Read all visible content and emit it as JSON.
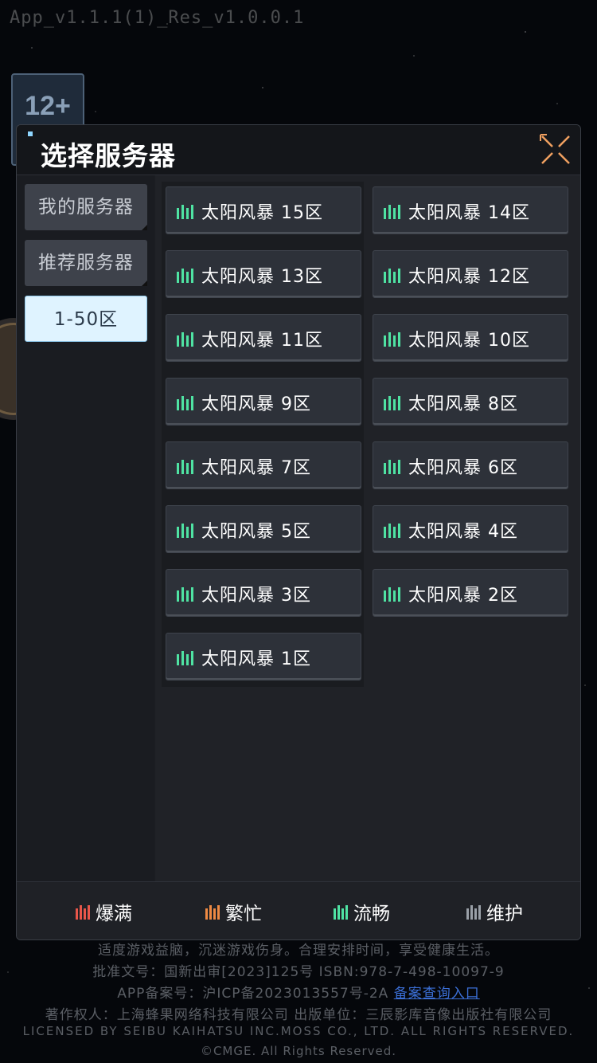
{
  "version": "App_v1.1.1(1)_Res_v1.0.0.1",
  "age_badge": "12+",
  "dialog": {
    "title": "选择服务器",
    "tabs": [
      {
        "label": "我的服务器",
        "active": false
      },
      {
        "label": "推荐服务器",
        "active": false
      },
      {
        "label": "1-50区",
        "active": true
      }
    ],
    "servers": [
      {
        "name": "太阳风暴 15区",
        "status": "smooth"
      },
      {
        "name": "太阳风暴 14区",
        "status": "smooth"
      },
      {
        "name": "太阳风暴 13区",
        "status": "smooth"
      },
      {
        "name": "太阳风暴 12区",
        "status": "smooth"
      },
      {
        "name": "太阳风暴 11区",
        "status": "smooth"
      },
      {
        "name": "太阳风暴 10区",
        "status": "smooth"
      },
      {
        "name": "太阳风暴 9区",
        "status": "smooth"
      },
      {
        "name": "太阳风暴 8区",
        "status": "smooth"
      },
      {
        "name": "太阳风暴 7区",
        "status": "smooth"
      },
      {
        "name": "太阳风暴 6区",
        "status": "smooth"
      },
      {
        "name": "太阳风暴 5区",
        "status": "smooth"
      },
      {
        "name": "太阳风暴 4区",
        "status": "smooth"
      },
      {
        "name": "太阳风暴 3区",
        "status": "smooth"
      },
      {
        "name": "太阳风暴 2区",
        "status": "smooth"
      },
      {
        "name": "太阳风暴 1区",
        "status": "smooth"
      }
    ],
    "legend": [
      {
        "label": "爆满",
        "color": "#e8564a"
      },
      {
        "label": "繁忙",
        "color": "#ef8a43"
      },
      {
        "label": "流畅",
        "color": "#4fe3a3"
      },
      {
        "label": "维护",
        "color": "#9aa0a8"
      }
    ]
  },
  "notices": {
    "line1": "适度游戏益脑，沉迷游戏伤身。合理安排时间，享受健康生活。",
    "line2": "批准文号：国新出审[2023]125号 ISBN:978-7-498-10097-9",
    "line3_prefix": "APP备案号：沪ICP备2023013557号-2A",
    "line3_link": "备案查询入口",
    "line4": "著作权人：上海蜂果网络科技有限公司 出版单位：三辰影库音像出版社有限公司",
    "line5": "LICENSED BY SEIBU KAIHATSU INC.MOSS CO., LTD. ALL RIGHTS RESERVED.",
    "line6": "©CMGE. All Rights Reserved."
  },
  "colors": {
    "smooth": "#4fe3a3",
    "accent_close": "#f0a060",
    "active_tab": "#dff3ff"
  }
}
